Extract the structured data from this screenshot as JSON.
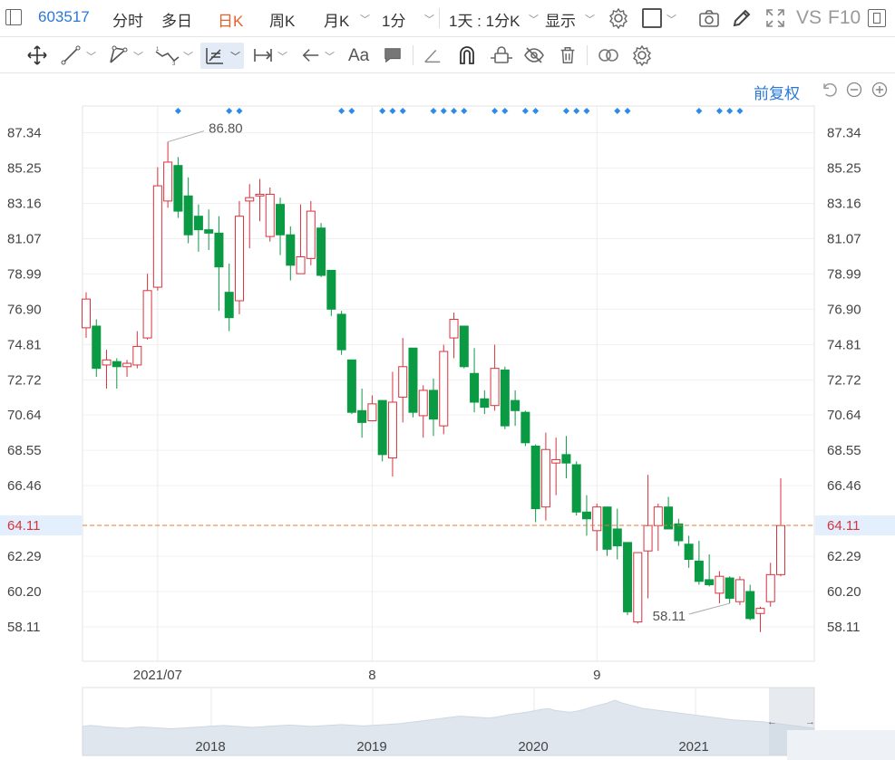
{
  "toolbar": {
    "code": "603517",
    "tabs": [
      {
        "label": "分时",
        "active": false
      },
      {
        "label": "多日",
        "active": false
      },
      {
        "label": "日K",
        "active": true
      },
      {
        "label": "周K",
        "active": false
      },
      {
        "label": "月K",
        "active": false
      }
    ],
    "interval": "1分",
    "range": "1天 : 1分K",
    "display": "显示",
    "vs": "VS",
    "f10": "F10",
    "icons": [
      "panel-icon",
      "settings-icon",
      "square-icon",
      "camera-icon",
      "pencil-icon",
      "fullscreen-icon",
      "window-icon"
    ]
  },
  "drawing_tools": {
    "font_label": "Aa",
    "icons": [
      "move-icon",
      "line-tool-icon",
      "polyline-tool-icon",
      "wave-tool-icon",
      "measure-tool-icon",
      "range-tool-icon",
      "arrow-tool-icon",
      "text-tool-icon",
      "comment-icon",
      "angle-tool-icon",
      "magnet-icon",
      "lock-icon",
      "hide-icon",
      "delete-icon",
      "link-icon",
      "gear-icon"
    ]
  },
  "sub_toolbar": {
    "adjust_label": "前复权",
    "icons": [
      "undo-icon",
      "zoom-out-icon",
      "zoom-in-icon"
    ]
  },
  "colors": {
    "up": "#d8323c",
    "down": "#0a9a44",
    "price_line": "#e07b39",
    "accent": "#2a78d6",
    "marker": "#2b8bea"
  },
  "chart_data": {
    "type": "candlestick",
    "yticks": [
      "87.34",
      "85.25",
      "83.16",
      "81.07",
      "78.99",
      "76.90",
      "74.81",
      "72.72",
      "70.64",
      "68.55",
      "66.46",
      "64.11",
      "62.29",
      "60.20",
      "58.11"
    ],
    "ylim": [
      58.11,
      87.34
    ],
    "x_labels": [
      {
        "label": "2021/07",
        "index": 7
      },
      {
        "label": "8",
        "index": 28
      },
      {
        "label": "9",
        "index": 50
      }
    ],
    "current_price": 64.11,
    "high_label": "86.80",
    "low_label": "58.11",
    "high_index": 8,
    "low_index": 63,
    "marker_indices": [
      9,
      14,
      15,
      25,
      26,
      29,
      30,
      31,
      34,
      35,
      36,
      37,
      40,
      41,
      43,
      44,
      47,
      48,
      49,
      52,
      53,
      60,
      62,
      63,
      64
    ],
    "candles": [
      {
        "o": 75.8,
        "h": 77.9,
        "l": 75.2,
        "c": 77.5
      },
      {
        "o": 75.9,
        "h": 76.3,
        "l": 72.9,
        "c": 73.4
      },
      {
        "o": 73.6,
        "h": 74.5,
        "l": 72.2,
        "c": 73.9
      },
      {
        "o": 73.8,
        "h": 74.0,
        "l": 72.2,
        "c": 73.5
      },
      {
        "o": 73.5,
        "h": 73.9,
        "l": 72.9,
        "c": 73.7
      },
      {
        "o": 73.6,
        "h": 75.6,
        "l": 73.4,
        "c": 74.7
      },
      {
        "o": 75.2,
        "h": 79.0,
        "l": 75.1,
        "c": 78.0
      },
      {
        "o": 78.2,
        "h": 85.3,
        "l": 78.0,
        "c": 84.2
      },
      {
        "o": 83.3,
        "h": 86.8,
        "l": 82.9,
        "c": 85.6
      },
      {
        "o": 85.4,
        "h": 85.9,
        "l": 82.3,
        "c": 82.7
      },
      {
        "o": 83.6,
        "h": 84.7,
        "l": 80.8,
        "c": 81.3
      },
      {
        "o": 82.4,
        "h": 83.1,
        "l": 80.3,
        "c": 81.6
      },
      {
        "o": 81.6,
        "h": 82.8,
        "l": 80.4,
        "c": 81.4
      },
      {
        "o": 81.4,
        "h": 82.4,
        "l": 76.8,
        "c": 79.4
      },
      {
        "o": 77.9,
        "h": 79.6,
        "l": 75.6,
        "c": 76.4
      },
      {
        "o": 77.4,
        "h": 83.3,
        "l": 76.6,
        "c": 82.4
      },
      {
        "o": 83.3,
        "h": 84.3,
        "l": 80.5,
        "c": 83.5
      },
      {
        "o": 83.6,
        "h": 84.6,
        "l": 82.1,
        "c": 83.7
      },
      {
        "o": 81.2,
        "h": 84.1,
        "l": 80.9,
        "c": 83.7
      },
      {
        "o": 83.1,
        "h": 83.5,
        "l": 80.1,
        "c": 81.3
      },
      {
        "o": 81.3,
        "h": 81.8,
        "l": 78.6,
        "c": 79.5
      },
      {
        "o": 79.0,
        "h": 83.1,
        "l": 79.0,
        "c": 80.0
      },
      {
        "o": 79.9,
        "h": 83.3,
        "l": 79.5,
        "c": 82.7
      },
      {
        "o": 81.7,
        "h": 82.0,
        "l": 78.8,
        "c": 78.9
      },
      {
        "o": 79.2,
        "h": 79.2,
        "l": 76.5,
        "c": 76.9
      },
      {
        "o": 76.6,
        "h": 76.8,
        "l": 74.2,
        "c": 74.5
      },
      {
        "o": 73.9,
        "h": 73.9,
        "l": 70.7,
        "c": 70.8
      },
      {
        "o": 70.9,
        "h": 72.2,
        "l": 69.3,
        "c": 70.2
      },
      {
        "o": 70.3,
        "h": 71.8,
        "l": 70.3,
        "c": 71.3
      },
      {
        "o": 71.5,
        "h": 71.5,
        "l": 67.9,
        "c": 68.3
      },
      {
        "o": 68.1,
        "h": 73.2,
        "l": 67.0,
        "c": 71.4
      },
      {
        "o": 71.7,
        "h": 75.2,
        "l": 70.2,
        "c": 73.5
      },
      {
        "o": 74.6,
        "h": 74.6,
        "l": 70.5,
        "c": 70.8
      },
      {
        "o": 70.6,
        "h": 72.4,
        "l": 69.3,
        "c": 72.1
      },
      {
        "o": 72.1,
        "h": 72.8,
        "l": 69.4,
        "c": 70.4
      },
      {
        "o": 70.0,
        "h": 74.8,
        "l": 69.5,
        "c": 74.4
      },
      {
        "o": 75.2,
        "h": 76.7,
        "l": 74.0,
        "c": 76.3
      },
      {
        "o": 75.9,
        "h": 75.9,
        "l": 73.4,
        "c": 73.5
      },
      {
        "o": 73.1,
        "h": 74.6,
        "l": 70.8,
        "c": 71.4
      },
      {
        "o": 71.6,
        "h": 72.1,
        "l": 70.7,
        "c": 71.1
      },
      {
        "o": 71.2,
        "h": 74.8,
        "l": 70.9,
        "c": 73.4
      },
      {
        "o": 73.3,
        "h": 73.5,
        "l": 69.8,
        "c": 70.0
      },
      {
        "o": 71.5,
        "h": 72.1,
        "l": 70.0,
        "c": 70.9
      },
      {
        "o": 70.8,
        "h": 70.9,
        "l": 68.8,
        "c": 69.0
      },
      {
        "o": 68.8,
        "h": 68.9,
        "l": 64.3,
        "c": 65.1
      },
      {
        "o": 65.2,
        "h": 69.6,
        "l": 64.4,
        "c": 68.6
      },
      {
        "o": 67.8,
        "h": 69.3,
        "l": 65.9,
        "c": 68.0
      },
      {
        "o": 68.3,
        "h": 69.4,
        "l": 66.9,
        "c": 67.8
      },
      {
        "o": 67.7,
        "h": 67.9,
        "l": 64.7,
        "c": 64.9
      },
      {
        "o": 64.9,
        "h": 65.9,
        "l": 63.5,
        "c": 64.5
      },
      {
        "o": 63.8,
        "h": 65.4,
        "l": 62.6,
        "c": 65.2
      },
      {
        "o": 65.2,
        "h": 65.2,
        "l": 62.3,
        "c": 62.7
      },
      {
        "o": 63.9,
        "h": 65.1,
        "l": 62.1,
        "c": 62.9
      },
      {
        "o": 63.1,
        "h": 63.1,
        "l": 58.8,
        "c": 59.0
      },
      {
        "o": 58.4,
        "h": 61.3,
        "l": 58.3,
        "c": 62.5
      },
      {
        "o": 62.6,
        "h": 67.1,
        "l": 59.8,
        "c": 64.1
      },
      {
        "o": 64.1,
        "h": 65.4,
        "l": 62.6,
        "c": 65.2
      },
      {
        "o": 65.2,
        "h": 65.8,
        "l": 63.9,
        "c": 63.9
      },
      {
        "o": 64.2,
        "h": 64.5,
        "l": 62.9,
        "c": 63.2
      },
      {
        "o": 63.0,
        "h": 63.5,
        "l": 61.6,
        "c": 62.1
      },
      {
        "o": 62.0,
        "h": 63.2,
        "l": 60.6,
        "c": 60.8
      },
      {
        "o": 60.9,
        "h": 62.4,
        "l": 60.5,
        "c": 60.6
      },
      {
        "o": 60.1,
        "h": 61.4,
        "l": 59.5,
        "c": 61.1
      },
      {
        "o": 61.0,
        "h": 61.1,
        "l": 59.5,
        "c": 59.8
      },
      {
        "o": 59.6,
        "h": 61.1,
        "l": 59.4,
        "c": 60.9
      },
      {
        "o": 60.2,
        "h": 60.6,
        "l": 58.5,
        "c": 58.6
      },
      {
        "o": 58.9,
        "h": 59.3,
        "l": 57.8,
        "c": 59.2
      },
      {
        "o": 59.6,
        "h": 61.9,
        "l": 59.3,
        "c": 61.2
      },
      {
        "o": 61.2,
        "h": 66.9,
        "l": 61.1,
        "c": 64.1
      }
    ],
    "navigator": {
      "year_labels": [
        "2018",
        "2019",
        "2020",
        "2021"
      ],
      "history": [
        62,
        64,
        63,
        61,
        60,
        59,
        58,
        60,
        61,
        60,
        59,
        58,
        57,
        58,
        59,
        60,
        61,
        62,
        63,
        64,
        63,
        62,
        61,
        60,
        61,
        62,
        63,
        64,
        65,
        64,
        63,
        62,
        63,
        64,
        65,
        66,
        65,
        64,
        63,
        64,
        65,
        66,
        67,
        68,
        70,
        72,
        74,
        76,
        78,
        80,
        82,
        84,
        83,
        82,
        81,
        80,
        82,
        85,
        88,
        90,
        92,
        95,
        98,
        100,
        96,
        94,
        92,
        95,
        99,
        104,
        108,
        112,
        118,
        112,
        108,
        104,
        100,
        98,
        96,
        94,
        92,
        90,
        88,
        86,
        84,
        82,
        80,
        78,
        76,
        75,
        74,
        73,
        72,
        70,
        68,
        66,
        64,
        62,
        60,
        58
      ]
    }
  }
}
